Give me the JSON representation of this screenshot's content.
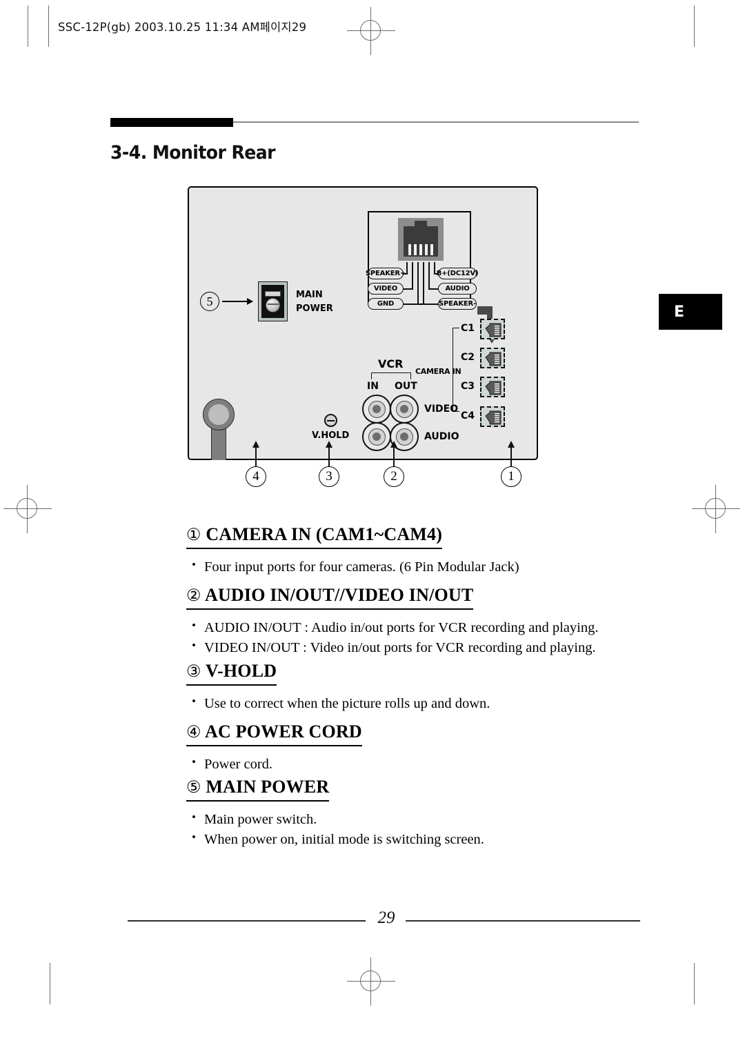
{
  "print_header": {
    "text": "SSC-12P(gb)  2003.10.25 11:34 AM페이지29"
  },
  "title": {
    "text": "3-4. Monitor Rear"
  },
  "side_tab": {
    "label": "E"
  },
  "diagram": {
    "main_power": {
      "callout": "5",
      "label_line1": "MAIN",
      "label_line2": "POWER"
    },
    "pinout": {
      "left_labels": [
        "SPEAKER+",
        "VIDEO",
        "GND"
      ],
      "right_labels": [
        "B+(DC12V)",
        "AUDIO",
        "SPEAKER-"
      ]
    },
    "camera_in": {
      "group_label": "CAMERA IN",
      "ports": [
        "C1",
        "C2",
        "C3",
        "C4"
      ]
    },
    "vcr": {
      "group_label": "VCR",
      "in_label": "IN",
      "out_label": "OUT",
      "video_label": "VIDEO",
      "audio_label": "AUDIO"
    },
    "vhold": {
      "label": "V.HOLD"
    },
    "callouts": [
      "4",
      "3",
      "2",
      "1"
    ]
  },
  "sections": [
    {
      "num": "①",
      "heading": "CAMERA IN (CAM1~CAM4)",
      "bullets": [
        "Four input ports for four cameras. (6 Pin Modular Jack)"
      ]
    },
    {
      "num": "②",
      "heading": "AUDIO IN/OUT//VIDEO IN/OUT",
      "bullets": [
        "AUDIO IN/OUT : Audio in/out ports for VCR recording and playing.",
        "VIDEO IN/OUT : Video in/out ports for VCR recording and playing."
      ]
    },
    {
      "num": "③",
      "heading": "V-HOLD",
      "bullets": [
        "Use to correct when the picture rolls up and down."
      ]
    },
    {
      "num": "④",
      "heading": "AC POWER CORD",
      "bullets": [
        "Power cord."
      ]
    },
    {
      "num": "⑤",
      "heading": "MAIN POWER",
      "bullets": [
        "Main power switch.",
        "When power on, initial mode is switching screen."
      ]
    }
  ],
  "footer": {
    "page_number": "29"
  },
  "colors": {
    "panel": "#e6e7e6",
    "ink": "#000000",
    "rule": "#8a8a8a"
  }
}
